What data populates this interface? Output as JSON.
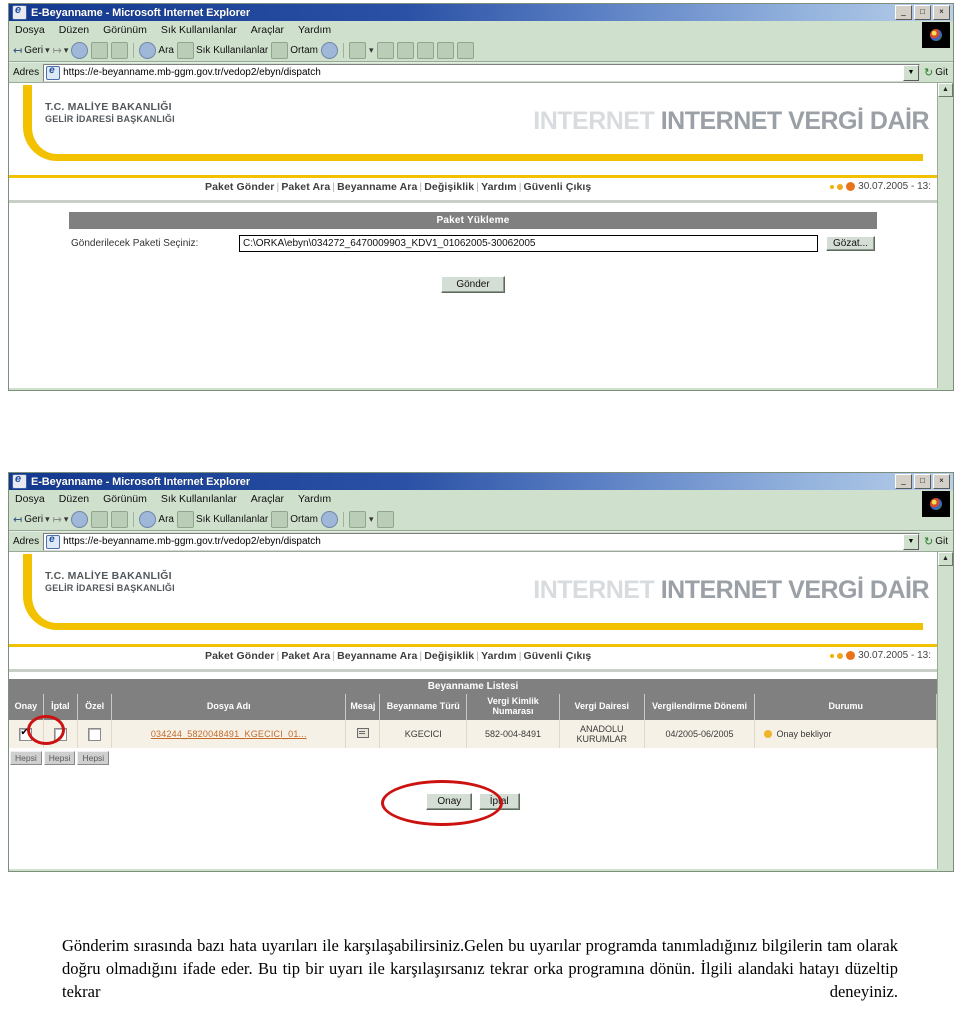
{
  "browser": {
    "title": "E-Beyanname - Microsoft Internet Explorer",
    "window_buttons": {
      "minimize": "_",
      "maximize": "□",
      "close": "×"
    },
    "menu": [
      "Dosya",
      "Düzen",
      "Görünüm",
      "Sık Kullanılanlar",
      "Araçlar",
      "Yardım"
    ],
    "toolbar": {
      "back": "Geri",
      "forward": "",
      "stop": "",
      "refresh": "",
      "home": "",
      "search": "Ara",
      "favorites": "Sık Kullanılanlar",
      "media": "Ortam",
      "history": "",
      "mail": "",
      "print": "",
      "edit": "",
      "discuss": "",
      "messenger": "",
      "research": ""
    },
    "address": {
      "label": "Adres",
      "url": "https://e-beyanname.mb-ggm.gov.tr/vedop2/ebyn/dispatch",
      "go_label": "Git",
      "dropdown_caret": "▼"
    }
  },
  "site": {
    "ministry_line1": "T.C. MALİYE BAKANLIĞI",
    "ministry_line2": "GELİR İDARESİ BAŞKANLIĞI",
    "banner_text": "INTERNET VERGİ DAİR",
    "banner_ghost": "INTERNET",
    "nav": [
      "Paket Gönder",
      "Paket Ara",
      "Beyanname Ara",
      "Değişiklik",
      "Yardım",
      "Güvenli Çıkış"
    ],
    "nav_separator": "|",
    "timestamp": "30.07.2005 - 13:"
  },
  "screen1": {
    "panel_title": "Paket Yükleme",
    "file_label": "Gönderilecek Paketi Seçiniz:",
    "file_value": "C:\\ORKA\\ebyn\\034272_6470009903_KDV1_01062005-30062005",
    "browse_button": "Gözat...",
    "submit_button": "Gönder"
  },
  "screen2": {
    "list_title": "Beyanname Listesi",
    "columns": [
      "Onay",
      "İptal",
      "Özel",
      "Dosya Adı",
      "Mesaj",
      "Beyanname Türü",
      "Vergi Kimlik Numarası",
      "Vergi Dairesi",
      "Vergilendirme Dönemi",
      "Durumu"
    ],
    "rows": [
      {
        "onay_checked": true,
        "iptal_checked": false,
        "ozel_checked": false,
        "dosya_adi": "034244_5820048491_KGECICI_01...",
        "mesaj": "mail-icon",
        "beyanname_turu": "KGECICI",
        "vergi_kimlik_numarasi": "582-004-8491",
        "vergi_dairesi": "ANADOLU KURUMLAR",
        "vergilendirme_donemi": "04/2005-06/2005",
        "durumu": "Onay bekliyor",
        "durumu_color": "#f0b32a"
      }
    ],
    "select_all_buttons": [
      "Hepsi",
      "Hepsi",
      "Hepsi"
    ],
    "confirm_button": "Onay",
    "cancel_button": "İptal",
    "annotation": "red-ellipse-highlight"
  },
  "caption": {
    "text": "Gönderim sırasında bazı hata uyarıları ile karşılaşabilirsiniz.Gelen bu uyarılar programda tanımladığınız bilgilerin tam olarak doğru olmadığını ifade eder. Bu tip bir uyarı ile karşılaşırsanız tekrar orka programına dönün. İlgili alandaki hatayı düzeltip tekrar deneyiniz."
  },
  "colors": {
    "chrome": "#cfe0cd",
    "titlebar": "#12398f",
    "accent_yellow": "#f2c200",
    "table_header": "#808080",
    "row_bg": "#f6f1e6",
    "link": "#c26a2a",
    "annotation_red": "#cc1111"
  }
}
